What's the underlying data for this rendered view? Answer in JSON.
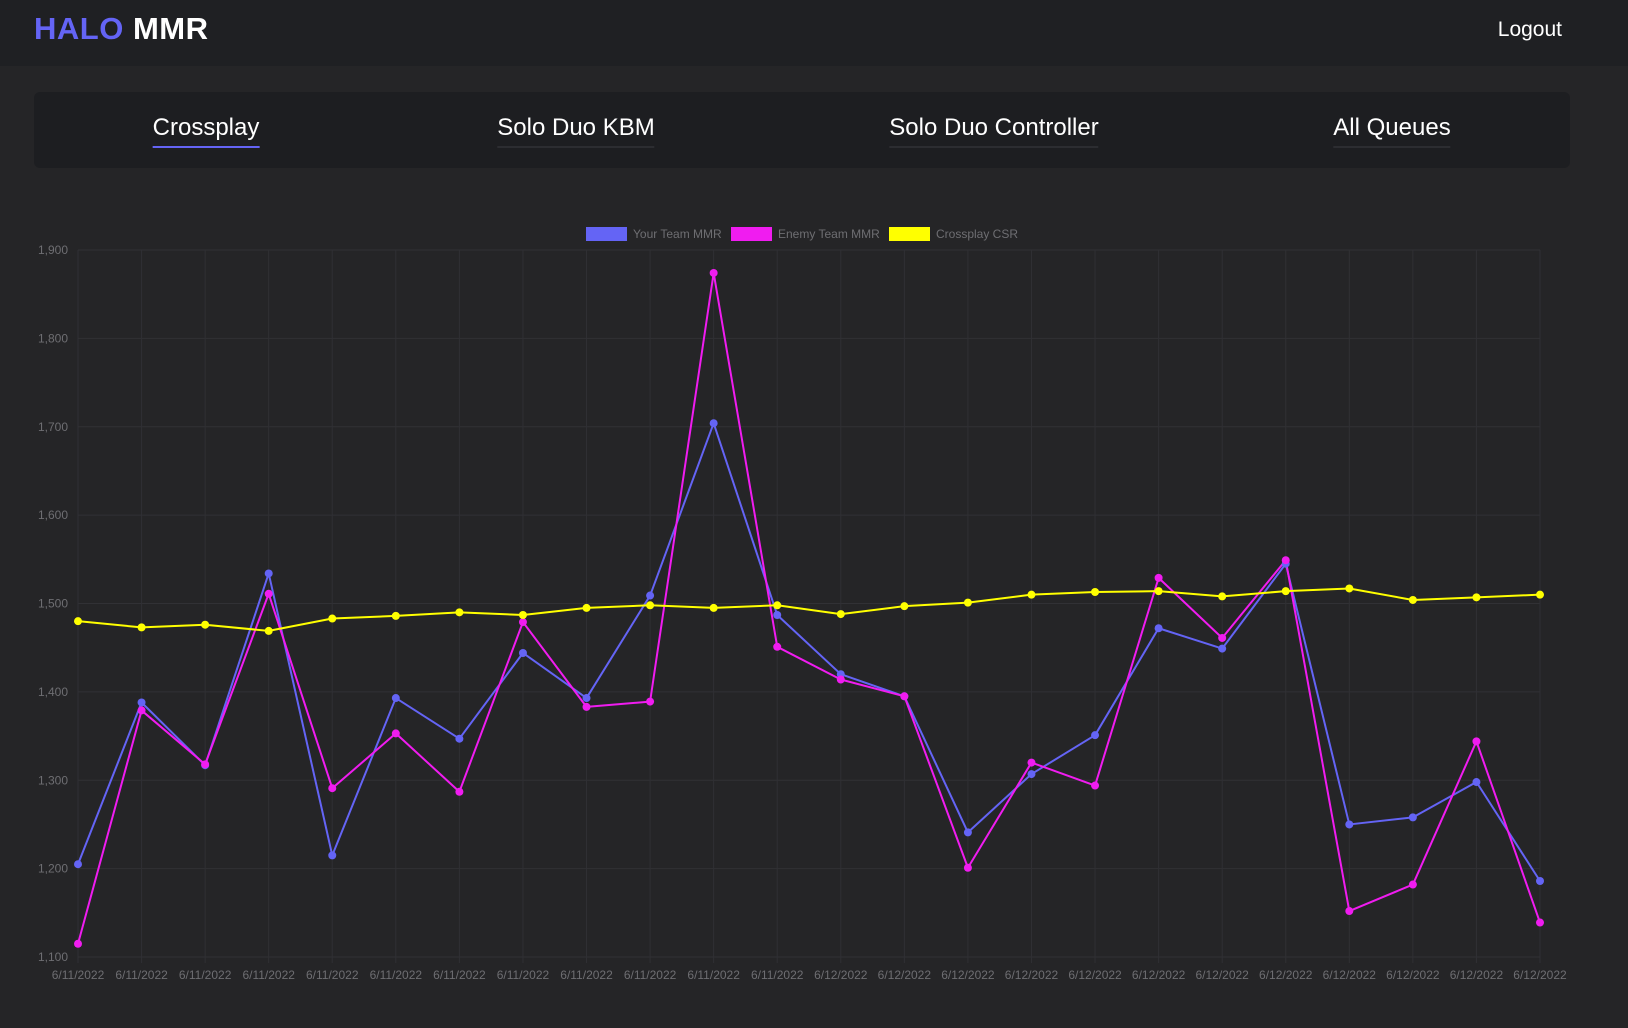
{
  "header": {
    "brand_part1": "HALO",
    "brand_part2": "MMR",
    "logout_label": "Logout"
  },
  "tabs": [
    {
      "label": "Crossplay",
      "active": true
    },
    {
      "label": "Solo Duo KBM",
      "active": false
    },
    {
      "label": "Solo Duo Controller",
      "active": false
    },
    {
      "label": "All Queues",
      "active": false
    }
  ],
  "colors": {
    "accent": "#6464f5",
    "enemy": "#f01cf0",
    "csr": "#ffff00",
    "background": "#252527",
    "panel": "#1d1e21"
  },
  "chart_data": {
    "type": "line",
    "title": "",
    "xlabel": "",
    "ylabel": "",
    "ylim": [
      1100,
      1900
    ],
    "yticks": [
      "1,900",
      "1,800",
      "1,700",
      "1,600",
      "1,500",
      "1,400",
      "1,300",
      "1,200",
      "1,100"
    ],
    "grid": true,
    "legend_position": "top-center",
    "categories": [
      "6/11/2022",
      "6/11/2022",
      "6/11/2022",
      "6/11/2022",
      "6/11/2022",
      "6/11/2022",
      "6/11/2022",
      "6/11/2022",
      "6/11/2022",
      "6/11/2022",
      "6/11/2022",
      "6/11/2022",
      "6/12/2022",
      "6/12/2022",
      "6/12/2022",
      "6/12/2022",
      "6/12/2022",
      "6/12/2022",
      "6/12/2022",
      "6/12/2022",
      "6/12/2022",
      "6/12/2022",
      "6/12/2022",
      "6/12/2022"
    ],
    "series": [
      {
        "name": "Your Team MMR",
        "color": "#6464f5",
        "values": [
          1205,
          1388,
          1317,
          1534,
          1215,
          1393,
          1347,
          1444,
          1393,
          1509,
          1704,
          1487,
          1420,
          1395,
          1241,
          1307,
          1351,
          1472,
          1449,
          1545,
          1250,
          1258,
          1298,
          1186
        ]
      },
      {
        "name": "Enemy Team MMR",
        "color": "#f01cf0",
        "values": [
          1115,
          1379,
          1318,
          1511,
          1291,
          1353,
          1287,
          1479,
          1383,
          1389,
          1874,
          1451,
          1414,
          1395,
          1201,
          1320,
          1294,
          1529,
          1461,
          1549,
          1152,
          1182,
          1344,
          1139
        ]
      },
      {
        "name": "Crossplay CSR",
        "color": "#ffff00",
        "values": [
          1480,
          1473,
          1476,
          1469,
          1483,
          1486,
          1490,
          1487,
          1495,
          1498,
          1495,
          1498,
          1488,
          1497,
          1501,
          1510,
          1513,
          1514,
          1508,
          1514,
          1517,
          1504,
          1507,
          1510
        ]
      }
    ]
  }
}
